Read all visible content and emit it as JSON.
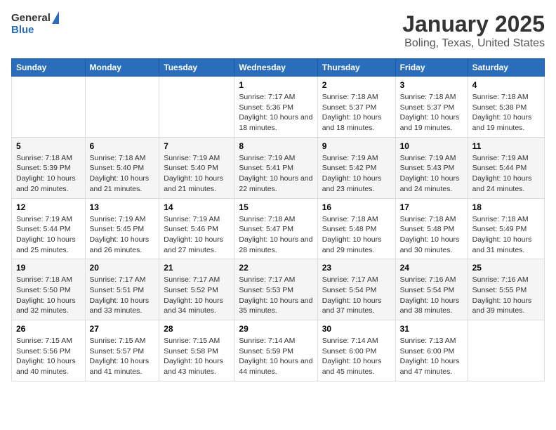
{
  "logo": {
    "general": "General",
    "blue": "Blue"
  },
  "title": "January 2025",
  "subtitle": "Boling, Texas, United States",
  "weekdays": [
    "Sunday",
    "Monday",
    "Tuesday",
    "Wednesday",
    "Thursday",
    "Friday",
    "Saturday"
  ],
  "weeks": [
    [
      {
        "day": "",
        "sunrise": "",
        "sunset": "",
        "daylight": ""
      },
      {
        "day": "",
        "sunrise": "",
        "sunset": "",
        "daylight": ""
      },
      {
        "day": "",
        "sunrise": "",
        "sunset": "",
        "daylight": ""
      },
      {
        "day": "1",
        "sunrise": "Sunrise: 7:17 AM",
        "sunset": "Sunset: 5:36 PM",
        "daylight": "Daylight: 10 hours and 18 minutes."
      },
      {
        "day": "2",
        "sunrise": "Sunrise: 7:18 AM",
        "sunset": "Sunset: 5:37 PM",
        "daylight": "Daylight: 10 hours and 18 minutes."
      },
      {
        "day": "3",
        "sunrise": "Sunrise: 7:18 AM",
        "sunset": "Sunset: 5:37 PM",
        "daylight": "Daylight: 10 hours and 19 minutes."
      },
      {
        "day": "4",
        "sunrise": "Sunrise: 7:18 AM",
        "sunset": "Sunset: 5:38 PM",
        "daylight": "Daylight: 10 hours and 19 minutes."
      }
    ],
    [
      {
        "day": "5",
        "sunrise": "Sunrise: 7:18 AM",
        "sunset": "Sunset: 5:39 PM",
        "daylight": "Daylight: 10 hours and 20 minutes."
      },
      {
        "day": "6",
        "sunrise": "Sunrise: 7:18 AM",
        "sunset": "Sunset: 5:40 PM",
        "daylight": "Daylight: 10 hours and 21 minutes."
      },
      {
        "day": "7",
        "sunrise": "Sunrise: 7:19 AM",
        "sunset": "Sunset: 5:40 PM",
        "daylight": "Daylight: 10 hours and 21 minutes."
      },
      {
        "day": "8",
        "sunrise": "Sunrise: 7:19 AM",
        "sunset": "Sunset: 5:41 PM",
        "daylight": "Daylight: 10 hours and 22 minutes."
      },
      {
        "day": "9",
        "sunrise": "Sunrise: 7:19 AM",
        "sunset": "Sunset: 5:42 PM",
        "daylight": "Daylight: 10 hours and 23 minutes."
      },
      {
        "day": "10",
        "sunrise": "Sunrise: 7:19 AM",
        "sunset": "Sunset: 5:43 PM",
        "daylight": "Daylight: 10 hours and 24 minutes."
      },
      {
        "day": "11",
        "sunrise": "Sunrise: 7:19 AM",
        "sunset": "Sunset: 5:44 PM",
        "daylight": "Daylight: 10 hours and 24 minutes."
      }
    ],
    [
      {
        "day": "12",
        "sunrise": "Sunrise: 7:19 AM",
        "sunset": "Sunset: 5:44 PM",
        "daylight": "Daylight: 10 hours and 25 minutes."
      },
      {
        "day": "13",
        "sunrise": "Sunrise: 7:19 AM",
        "sunset": "Sunset: 5:45 PM",
        "daylight": "Daylight: 10 hours and 26 minutes."
      },
      {
        "day": "14",
        "sunrise": "Sunrise: 7:19 AM",
        "sunset": "Sunset: 5:46 PM",
        "daylight": "Daylight: 10 hours and 27 minutes."
      },
      {
        "day": "15",
        "sunrise": "Sunrise: 7:18 AM",
        "sunset": "Sunset: 5:47 PM",
        "daylight": "Daylight: 10 hours and 28 minutes."
      },
      {
        "day": "16",
        "sunrise": "Sunrise: 7:18 AM",
        "sunset": "Sunset: 5:48 PM",
        "daylight": "Daylight: 10 hours and 29 minutes."
      },
      {
        "day": "17",
        "sunrise": "Sunrise: 7:18 AM",
        "sunset": "Sunset: 5:48 PM",
        "daylight": "Daylight: 10 hours and 30 minutes."
      },
      {
        "day": "18",
        "sunrise": "Sunrise: 7:18 AM",
        "sunset": "Sunset: 5:49 PM",
        "daylight": "Daylight: 10 hours and 31 minutes."
      }
    ],
    [
      {
        "day": "19",
        "sunrise": "Sunrise: 7:18 AM",
        "sunset": "Sunset: 5:50 PM",
        "daylight": "Daylight: 10 hours and 32 minutes."
      },
      {
        "day": "20",
        "sunrise": "Sunrise: 7:17 AM",
        "sunset": "Sunset: 5:51 PM",
        "daylight": "Daylight: 10 hours and 33 minutes."
      },
      {
        "day": "21",
        "sunrise": "Sunrise: 7:17 AM",
        "sunset": "Sunset: 5:52 PM",
        "daylight": "Daylight: 10 hours and 34 minutes."
      },
      {
        "day": "22",
        "sunrise": "Sunrise: 7:17 AM",
        "sunset": "Sunset: 5:53 PM",
        "daylight": "Daylight: 10 hours and 35 minutes."
      },
      {
        "day": "23",
        "sunrise": "Sunrise: 7:17 AM",
        "sunset": "Sunset: 5:54 PM",
        "daylight": "Daylight: 10 hours and 37 minutes."
      },
      {
        "day": "24",
        "sunrise": "Sunrise: 7:16 AM",
        "sunset": "Sunset: 5:54 PM",
        "daylight": "Daylight: 10 hours and 38 minutes."
      },
      {
        "day": "25",
        "sunrise": "Sunrise: 7:16 AM",
        "sunset": "Sunset: 5:55 PM",
        "daylight": "Daylight: 10 hours and 39 minutes."
      }
    ],
    [
      {
        "day": "26",
        "sunrise": "Sunrise: 7:15 AM",
        "sunset": "Sunset: 5:56 PM",
        "daylight": "Daylight: 10 hours and 40 minutes."
      },
      {
        "day": "27",
        "sunrise": "Sunrise: 7:15 AM",
        "sunset": "Sunset: 5:57 PM",
        "daylight": "Daylight: 10 hours and 41 minutes."
      },
      {
        "day": "28",
        "sunrise": "Sunrise: 7:15 AM",
        "sunset": "Sunset: 5:58 PM",
        "daylight": "Daylight: 10 hours and 43 minutes."
      },
      {
        "day": "29",
        "sunrise": "Sunrise: 7:14 AM",
        "sunset": "Sunset: 5:59 PM",
        "daylight": "Daylight: 10 hours and 44 minutes."
      },
      {
        "day": "30",
        "sunrise": "Sunrise: 7:14 AM",
        "sunset": "Sunset: 6:00 PM",
        "daylight": "Daylight: 10 hours and 45 minutes."
      },
      {
        "day": "31",
        "sunrise": "Sunrise: 7:13 AM",
        "sunset": "Sunset: 6:00 PM",
        "daylight": "Daylight: 10 hours and 47 minutes."
      },
      {
        "day": "",
        "sunrise": "",
        "sunset": "",
        "daylight": ""
      }
    ]
  ]
}
